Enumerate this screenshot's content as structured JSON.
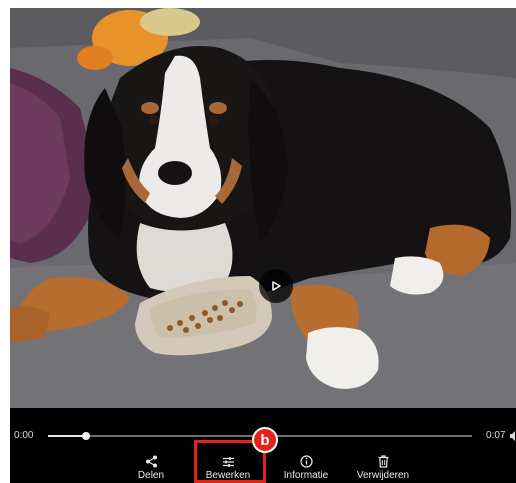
{
  "player": {
    "current_time": "0:00",
    "duration": "0:07",
    "progress": 0.09,
    "photo_subject": "dog-on-couch-with-food-bowl"
  },
  "actions": [
    {
      "label": "Delen",
      "icon": "share-icon"
    },
    {
      "label": "Bewerken",
      "icon": "tune-sliders-icon"
    },
    {
      "label": "Informatie",
      "icon": "info-icon"
    },
    {
      "label": "Verwijderen",
      "icon": "trash-icon"
    }
  ],
  "annotation": {
    "badge_letter": "b",
    "highlighted_action": "Bewerken",
    "color": "#e2231a"
  },
  "colors": {
    "control_bar": "#000000",
    "control_text": "#e8e8e8",
    "highlight": "#e2231a"
  }
}
